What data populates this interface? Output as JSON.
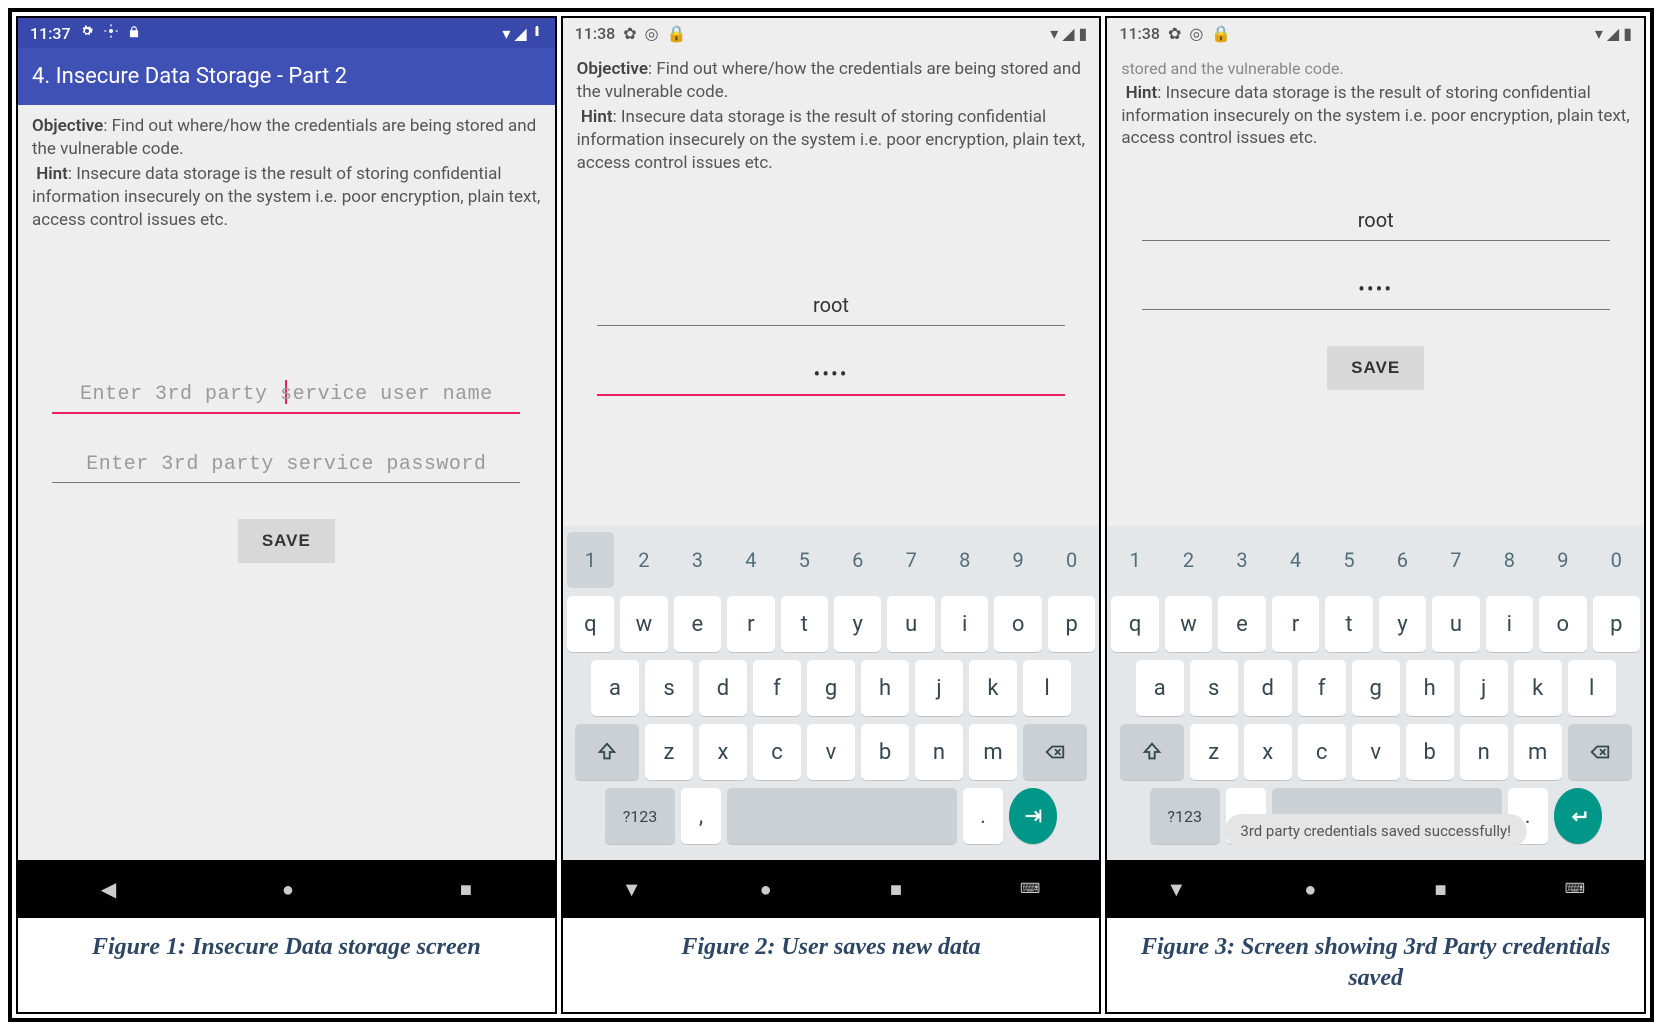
{
  "figures": [
    {
      "caption": "Figure 1: Insecure Data storage screen"
    },
    {
      "caption": "Figure 2: User saves new data"
    },
    {
      "caption": "Figure 3: Screen showing 3rd Party credentials saved"
    }
  ],
  "screen1": {
    "status_time": "11:37",
    "app_title": "4. Insecure Data Storage - Part 2",
    "objective_label": "Objective",
    "objective_text": ": Find out where/how the credentials are being stored and the vulnerable code.",
    "hint_label": "Hint",
    "hint_text": ": Insecure data storage is the result of storing confidential information insecurely on the system i.e. poor encryption, plain text, access control issues etc.",
    "username_placeholder": "Enter 3rd party service user name",
    "username_value": "",
    "password_placeholder": "Enter 3rd party service password",
    "password_value": "",
    "save_label": "SAVE"
  },
  "screen2": {
    "status_time": "11:38",
    "objective_label": "Objective",
    "objective_text": ": Find out where/how the credentials are being stored and the vulnerable code.",
    "hint_label": "Hint",
    "hint_text": ": Insecure data storage is the result of storing confidential information insecurely on the system i.e. poor encryption, plain text, access control issues etc.",
    "username_value": "root",
    "password_value": "••••"
  },
  "screen3": {
    "status_time": "11:38",
    "truncated_top": "stored and the vulnerable code.",
    "hint_label": "Hint",
    "hint_text": ": Insecure data storage is the result of storing confidential information insecurely on the system i.e. poor encryption, plain text, access control issues etc.",
    "username_value": "root",
    "password_value": "••••",
    "save_label": "SAVE",
    "toast": "3rd party credentials saved successfully!"
  },
  "keyboard": {
    "numbers": [
      "1",
      "2",
      "3",
      "4",
      "5",
      "6",
      "7",
      "8",
      "9",
      "0"
    ],
    "row1": [
      "q",
      "w",
      "e",
      "r",
      "t",
      "y",
      "u",
      "i",
      "o",
      "p"
    ],
    "row2": [
      "a",
      "s",
      "d",
      "f",
      "g",
      "h",
      "j",
      "k",
      "l"
    ],
    "row3": [
      "z",
      "x",
      "c",
      "v",
      "b",
      "n",
      "m"
    ],
    "sym_label": "?123",
    "comma": ",",
    "period": "."
  },
  "colors": {
    "primary": "#3f51b5",
    "primary_dark": "#3949ab",
    "accent": "#e91e63",
    "teal": "#009688"
  }
}
